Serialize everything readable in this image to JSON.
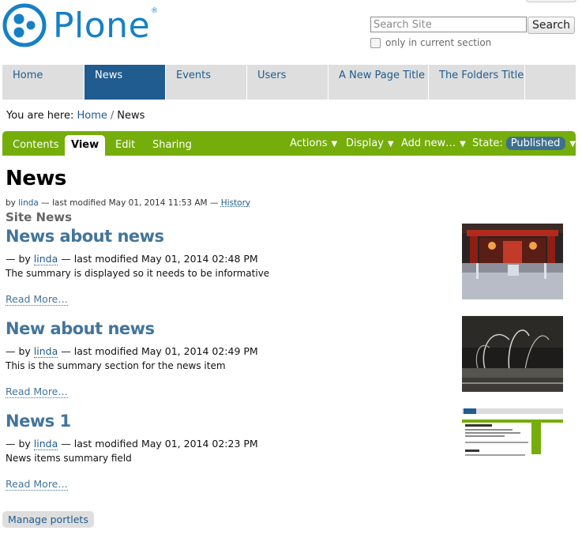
{
  "header": {
    "logo_text": "Plone",
    "logo_reg": "®",
    "search_placeholder": "Search Site",
    "search_button": "Search",
    "only_current_section": "only in current section"
  },
  "global_nav": [
    {
      "label": "Home",
      "selected": false
    },
    {
      "label": "News",
      "selected": true
    },
    {
      "label": "Events",
      "selected": false
    },
    {
      "label": "Users",
      "selected": false
    },
    {
      "label": "A New Page Title",
      "selected": false
    },
    {
      "label": "The Folders Title",
      "selected": false
    }
  ],
  "breadcrumb": {
    "prefix": "You are here:",
    "home": "Home",
    "separator": "/",
    "current": "News"
  },
  "editbar": {
    "tabs": {
      "contents": "Contents",
      "view": "View",
      "edit": "Edit",
      "sharing": "Sharing"
    },
    "menus": {
      "actions": "Actions",
      "display": "Display",
      "add_new": "Add new…",
      "state_label": "State:",
      "state_value": "Published"
    },
    "arrow": "▼"
  },
  "page": {
    "title": "News",
    "byline_prefix": "by",
    "byline_author": "linda",
    "byline_middle": "— last modified May 01, 2014 11:53 AM —",
    "history": "History",
    "section_title": "Site News"
  },
  "news_items": [
    {
      "title": "News about news",
      "byline_prefix": "— by",
      "author": "linda",
      "modified": "— last modified May 01, 2014 02:48 PM",
      "description": "The summary is displayed so it needs to be informative",
      "read_more": "Read More…",
      "thumb": "museum-hall-image"
    },
    {
      "title": "New about news",
      "byline_prefix": "— by",
      "author": "linda",
      "modified": "— last modified May 01, 2014 02:49 PM",
      "description": "This is the summary section for the news item",
      "read_more": "Read More…",
      "thumb": "fountain-image"
    },
    {
      "title": "News 1",
      "byline_prefix": "— by",
      "author": "linda",
      "modified": "— last modified May 01, 2014 02:23 PM",
      "description": "News items summary field",
      "read_more": "Read More…",
      "thumb": "plone-screenshot-image"
    }
  ],
  "footer": {
    "manage_portlets": "Manage portlets"
  },
  "colors": {
    "brand_blue": "#1680c6",
    "nav_selected": "#205c90",
    "editbar_green": "#75ad0a",
    "link": "#43759a"
  }
}
